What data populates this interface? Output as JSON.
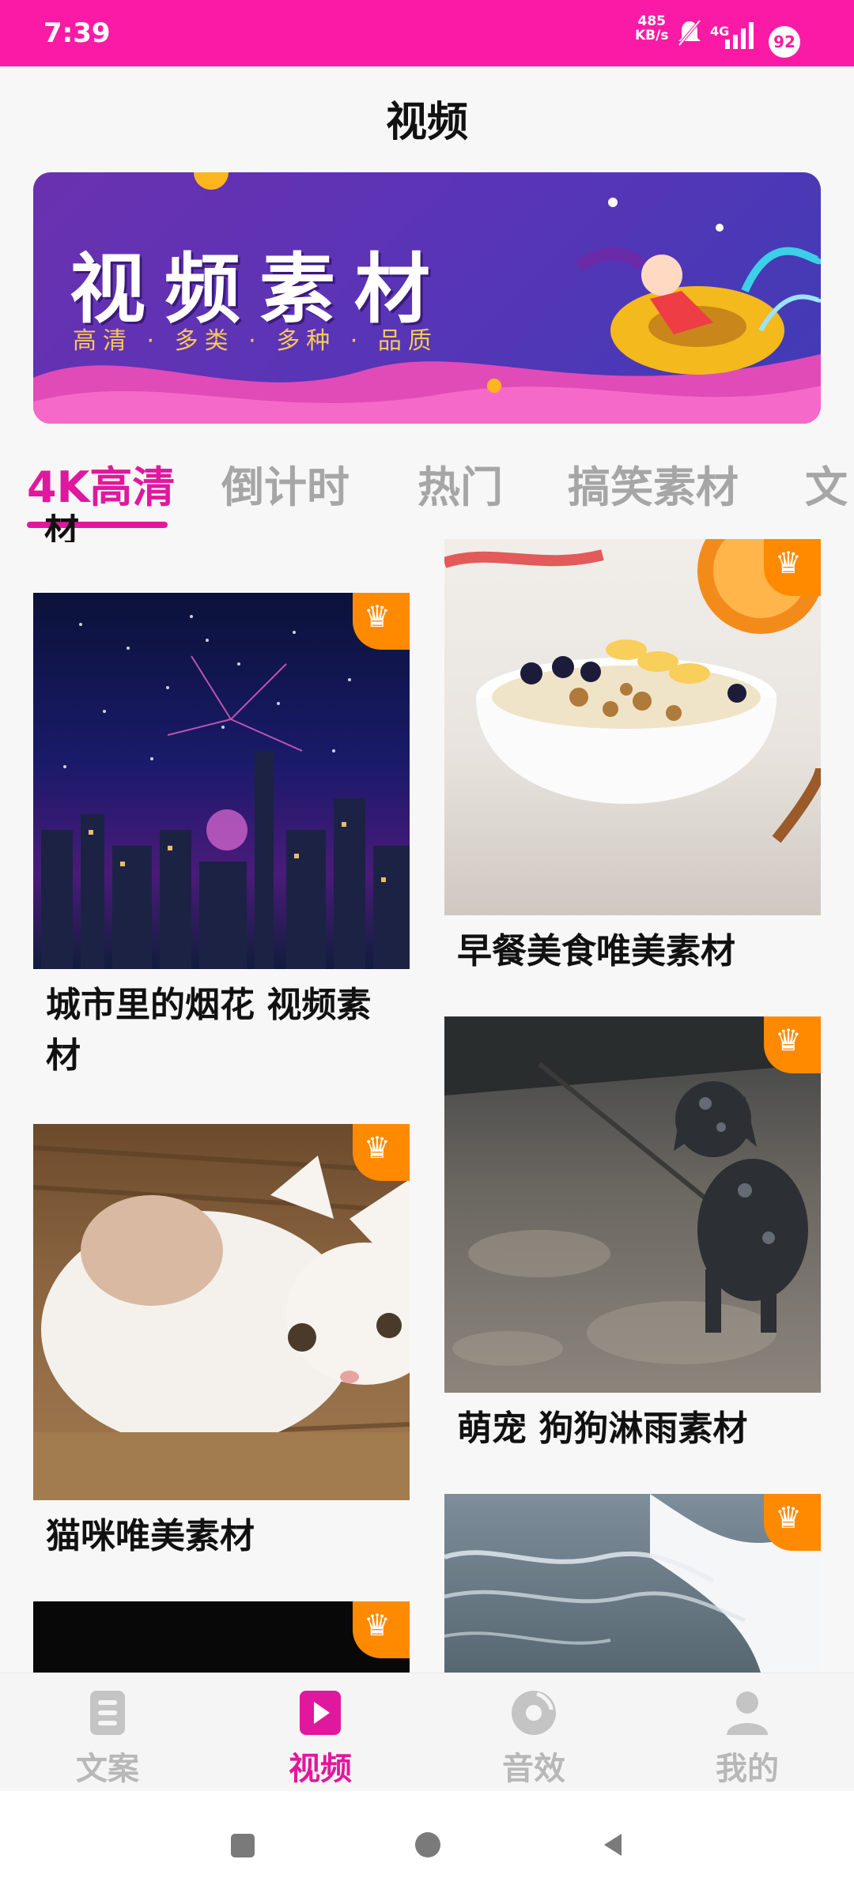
{
  "status": {
    "time": "7:39",
    "net_speed_top": "485",
    "net_speed_bottom": "KB/s",
    "net_type": "4G",
    "battery": "92"
  },
  "header": {
    "title": "视频"
  },
  "banner": {
    "title": "视频素材",
    "subtitle": "高清 · 多类 · 多种 · 品质"
  },
  "tabs": [
    {
      "label": "4K高清",
      "active": true
    },
    {
      "label": "倒计时"
    },
    {
      "label": "热门"
    },
    {
      "label": "搞笑素材"
    },
    {
      "label": "文"
    }
  ],
  "clipped_label": "材",
  "cards": [
    {
      "title": "城市里的烟花 视频素材",
      "icon": "crown-icon"
    },
    {
      "title": "早餐美食唯美素材",
      "icon": "crown-icon"
    },
    {
      "title": "猫咪唯美素材",
      "icon": "crown-icon"
    },
    {
      "title": "萌宠 狗狗淋雨素材",
      "icon": "crown-icon"
    },
    {
      "title": "",
      "icon": "crown-icon"
    },
    {
      "title": "",
      "icon": "crown-icon"
    }
  ],
  "bottom_nav": [
    {
      "label": "文案",
      "icon": "document-icon"
    },
    {
      "label": "视频",
      "icon": "video-play-icon",
      "active": true
    },
    {
      "label": "音效",
      "icon": "music-disc-icon"
    },
    {
      "label": "我的",
      "icon": "person-icon"
    }
  ],
  "colors": {
    "accent": "#e0189d",
    "status_bar": "#fb1aa6",
    "crown_badge": "#ff8a00"
  }
}
